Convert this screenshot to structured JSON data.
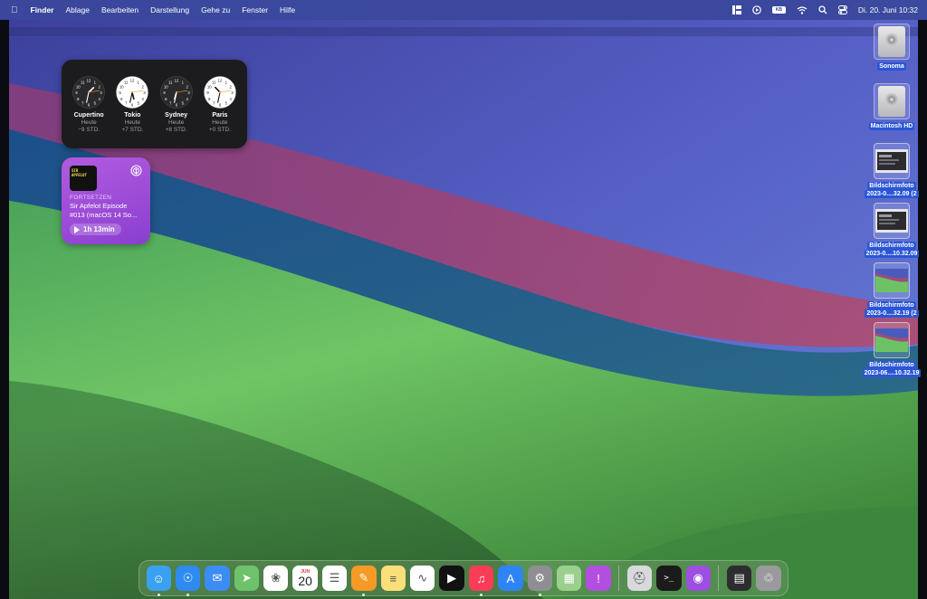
{
  "menubar": {
    "apple_icon": "apple-logo-icon",
    "app_name": "Finder",
    "items": [
      "Ablage",
      "Bearbeiten",
      "Darstellung",
      "Gehe zu",
      "Fenster",
      "Hilfe"
    ],
    "battery_label": "KB",
    "datetime": "Di. 20. Juni  10:32"
  },
  "clock_widget": {
    "clocks": [
      {
        "city": "Cupertino",
        "day": "Heute",
        "offset": "−9 STD.",
        "hour": 1,
        "minute": 32,
        "dark": true
      },
      {
        "city": "Tokio",
        "day": "Heute",
        "offset": "+7 STD.",
        "hour": 5,
        "minute": 32,
        "dark": false
      },
      {
        "city": "Sydney",
        "day": "Heute",
        "offset": "+8 STD.",
        "hour": 6,
        "minute": 32,
        "dark": true
      },
      {
        "city": "Paris",
        "day": "Heute",
        "offset": "+0 STD.",
        "hour": 10,
        "minute": 32,
        "dark": false
      }
    ]
  },
  "podcast_widget": {
    "art_text": "SIR APFELOT",
    "label": "FORTSETZEN",
    "title_line1": "Sir Apfelot Episode",
    "title_line2": "#013 (macOS 14 So...",
    "duration": "1h 13min"
  },
  "desktop_icons": [
    {
      "label_line1": "Sonoma",
      "label_line2": "",
      "kind": "hd"
    },
    {
      "label_line1": "Macintosh HD",
      "label_line2": "",
      "kind": "hd"
    },
    {
      "label_line1": "Bildschirmfoto",
      "label_line2": "2023-0....32.09 (2",
      "kind": "shot-dark"
    },
    {
      "label_line1": "Bildschirmfoto",
      "label_line2": "2023-0....10.32.09",
      "kind": "shot-dark"
    },
    {
      "label_line1": "Bildschirmfoto",
      "label_line2": "2023-0....32.19 (2",
      "kind": "shot-wall"
    },
    {
      "label_line1": "Bildschirmfoto",
      "label_line2": "2023-06....10.32.19",
      "kind": "shot-wall"
    }
  ],
  "dock": {
    "calendar_month": "JUN",
    "calendar_day": "20",
    "apps": [
      {
        "name": "finder-icon",
        "color": "#3aa1f2",
        "running": true
      },
      {
        "name": "safari-icon",
        "color": "#2f8bf0",
        "running": true
      },
      {
        "name": "mail-icon",
        "color": "#3b8df5",
        "running": false
      },
      {
        "name": "maps-icon",
        "color": "#6dc26b",
        "running": false
      },
      {
        "name": "photos-icon",
        "color": "#ffffff",
        "running": false
      },
      {
        "name": "calendar-icon",
        "color": "#ffffff",
        "running": false
      },
      {
        "name": "reminders-icon",
        "color": "#ffffff",
        "running": false
      },
      {
        "name": "pages-icon",
        "color": "#f59a25",
        "running": true
      },
      {
        "name": "notes-icon",
        "color": "#fbe07a",
        "running": false
      },
      {
        "name": "freeform-icon",
        "color": "#ffffff",
        "running": false
      },
      {
        "name": "apple-tv-icon",
        "color": "#111111",
        "running": false
      },
      {
        "name": "music-icon",
        "color": "#fa3c56",
        "running": true
      },
      {
        "name": "app-store-icon",
        "color": "#2f84f5",
        "running": false
      },
      {
        "name": "system-settings-icon",
        "color": "#8e8e93",
        "running": true
      },
      {
        "name": "launchpad-icon",
        "color": "#9ad08c",
        "running": false
      },
      {
        "name": "feedback-icon",
        "color": "#b34fe0",
        "running": false
      }
    ],
    "apps2": [
      {
        "name": "disk-utility-icon",
        "color": "#d9d9dc",
        "running": false
      },
      {
        "name": "terminal-icon",
        "color": "#1b1b1b",
        "running": false
      },
      {
        "name": "podcasts-icon",
        "color": "#9c4fe0",
        "running": false
      }
    ],
    "apps3": [
      {
        "name": "recent-document-icon",
        "color": "#2d2d30",
        "running": false
      },
      {
        "name": "trash-icon",
        "color": "#9a9a9e",
        "running": false
      }
    ]
  }
}
